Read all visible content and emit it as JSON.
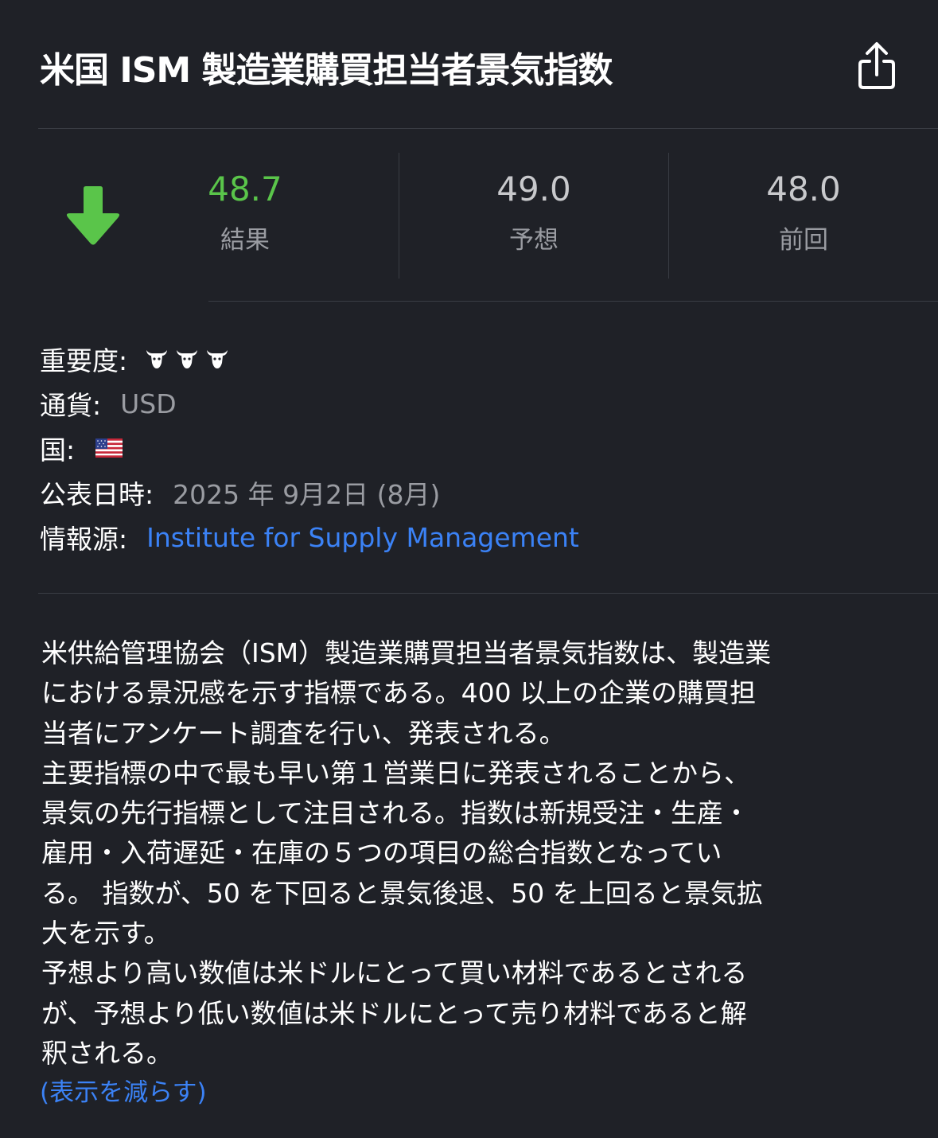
{
  "header": {
    "title": "米国 ISM 製造業購買担当者景気指数",
    "share_icon": "share-icon"
  },
  "stats": {
    "direction_icon": "arrow-down-icon",
    "actual": {
      "value": "48.7",
      "label": "結果"
    },
    "forecast": {
      "value": "49.0",
      "label": "予想"
    },
    "previous": {
      "value": "48.0",
      "label": "前回"
    },
    "colors": {
      "actual": "#5ac54a",
      "muted": "#c8c9cc"
    }
  },
  "info": {
    "importance": {
      "label": "重要度:",
      "level": 3,
      "max": 3,
      "icon": "bull-icon"
    },
    "currency": {
      "label": "通貨:",
      "value": "USD"
    },
    "country": {
      "label": "国:",
      "icon": "us-flag-icon"
    },
    "release": {
      "label": "公表日時:",
      "value": "2025 年 9月2日 (8月)"
    },
    "source": {
      "label": "情報源:",
      "value": "Institute for Supply Management"
    }
  },
  "description": {
    "lines": [
      "米供給管理協会（ISM）製造業購買担当者景気指数は、製造業",
      "における景況感を示す指標である。400 以上の企業の購買担",
      "当者にアンケート調査を行い、発表される。",
      "主要指標の中で最も早い第１営業日に発表されることから、",
      "景気の先行指標として注目される。指数は新規受注・生産・",
      "雇用・入荷遅延・在庫の５つの項目の総合指数となってい",
      "る。 指数が、50 を下回ると景気後退、50 を上回ると景気拡",
      "大を示す。",
      "予想より高い数値は米ドルにとって買い材料であるとされる",
      "が、予想より低い数値は米ドルにとって売り材料であると解",
      "釈される。"
    ],
    "toggle_label": "(表示を減らす)"
  }
}
